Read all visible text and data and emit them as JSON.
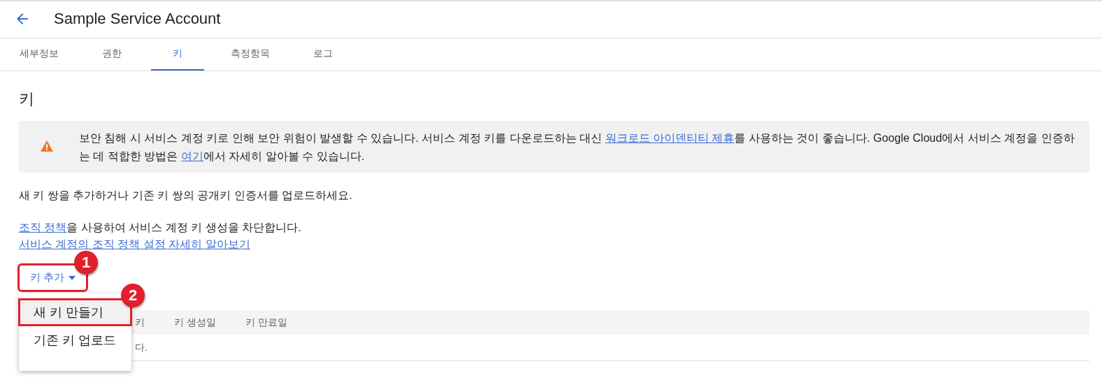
{
  "header": {
    "title": "Sample Service Account"
  },
  "tabs": [
    {
      "label": "세부정보",
      "selected": false
    },
    {
      "label": "권한",
      "selected": false
    },
    {
      "label": "키",
      "selected": true
    },
    {
      "label": "측정항목",
      "selected": false
    },
    {
      "label": "로그",
      "selected": false
    }
  ],
  "section_title": "키",
  "alert": {
    "parts": [
      {
        "kind": "text",
        "text": "보안 침해 시 서비스 계정 키로 인해 보안 위험이 발생할 수 있습니다. 서비스 계정 키를 다운로드하는 대신 "
      },
      {
        "kind": "link",
        "text": "워크로드 아이덴티티 제휴"
      },
      {
        "kind": "text",
        "text": "를 사용하는 것이 좋습니다. Google Cloud에서 서비스 계정을 인증하는 데 적합한 방법은 "
      },
      {
        "kind": "link",
        "text": "여기"
      },
      {
        "kind": "text",
        "text": "에서 자세히 알아볼 수 있습니다."
      }
    ]
  },
  "intro": "새 키 쌍을 추가하거나 기존 키 쌍의 공개키 인증서를 업로드하세요.",
  "policy": {
    "parts": [
      {
        "kind": "link",
        "text": "조직 정책"
      },
      {
        "kind": "text",
        "text": "을 사용하여 서비스 계정 키 생성을 차단합니다."
      }
    ],
    "learn_more": "서비스 계정의 조직 정책 설정 자세히 알아보기"
  },
  "add_key_button": {
    "label": "키 추가",
    "expanded": true
  },
  "menu": {
    "items": [
      {
        "label": "새 키 만들기",
        "selected": true
      },
      {
        "label": "기존 키 업로드",
        "selected": false
      }
    ]
  },
  "table": {
    "columns": [
      "키",
      "키 생성일",
      "키 만료일"
    ],
    "empty_text": "다."
  },
  "callouts": [
    {
      "number": "1"
    },
    {
      "number": "2"
    }
  ]
}
